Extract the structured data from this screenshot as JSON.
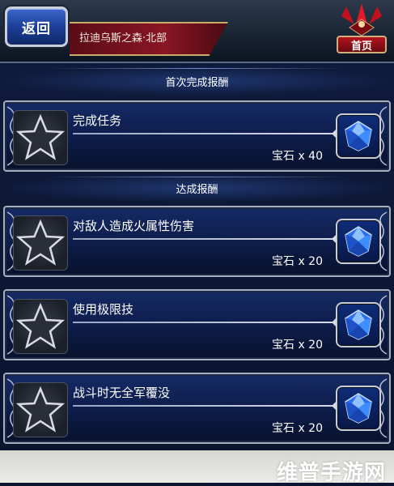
{
  "header": {
    "back_label": "返回",
    "location": "拉迪乌斯之森·北部",
    "home_label": "首页"
  },
  "sections": {
    "first_clear": "首次完成报酬",
    "achievement": "达成报酬"
  },
  "missions": [
    {
      "title": "完成任务",
      "reward": "宝石 x 40"
    },
    {
      "title": "对敌人造成火属性伤害",
      "reward": "宝石 x 20"
    },
    {
      "title": "使用极限技",
      "reward": "宝石 x 20"
    },
    {
      "title": "战斗时无全军覆没",
      "reward": "宝石 x 20"
    }
  ],
  "watermark": "维普手游网",
  "colors": {
    "back_button": "#1d3f99",
    "location_plate": "#8a1624",
    "card_background": "#152a66",
    "gem": "#3f8dff"
  },
  "icons": {
    "mission_status": "star-icon",
    "reward": "gem-icon",
    "home": "home-emblem-icon"
  }
}
